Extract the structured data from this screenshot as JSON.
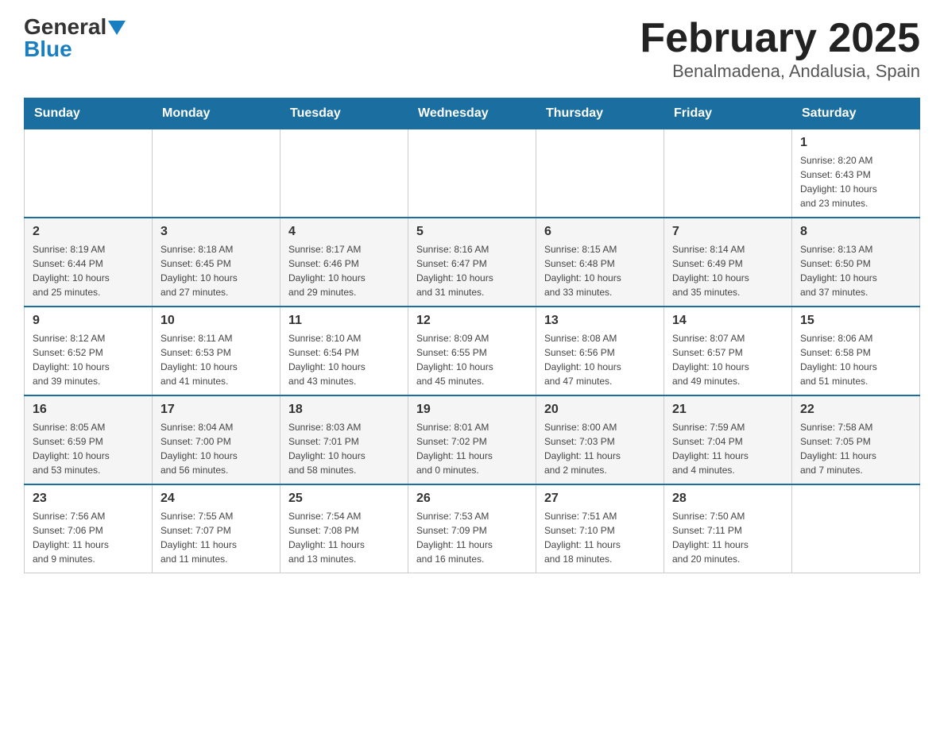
{
  "header": {
    "logo": {
      "general": "General",
      "blue": "Blue",
      "arrow": "▲"
    },
    "title": "February 2025",
    "subtitle": "Benalmadena, Andalusia, Spain"
  },
  "days_of_week": [
    "Sunday",
    "Monday",
    "Tuesday",
    "Wednesday",
    "Thursday",
    "Friday",
    "Saturday"
  ],
  "weeks": [
    {
      "days": [
        {
          "number": "",
          "info": ""
        },
        {
          "number": "",
          "info": ""
        },
        {
          "number": "",
          "info": ""
        },
        {
          "number": "",
          "info": ""
        },
        {
          "number": "",
          "info": ""
        },
        {
          "number": "",
          "info": ""
        },
        {
          "number": "1",
          "info": "Sunrise: 8:20 AM\nSunset: 6:43 PM\nDaylight: 10 hours\nand 23 minutes."
        }
      ]
    },
    {
      "days": [
        {
          "number": "2",
          "info": "Sunrise: 8:19 AM\nSunset: 6:44 PM\nDaylight: 10 hours\nand 25 minutes."
        },
        {
          "number": "3",
          "info": "Sunrise: 8:18 AM\nSunset: 6:45 PM\nDaylight: 10 hours\nand 27 minutes."
        },
        {
          "number": "4",
          "info": "Sunrise: 8:17 AM\nSunset: 6:46 PM\nDaylight: 10 hours\nand 29 minutes."
        },
        {
          "number": "5",
          "info": "Sunrise: 8:16 AM\nSunset: 6:47 PM\nDaylight: 10 hours\nand 31 minutes."
        },
        {
          "number": "6",
          "info": "Sunrise: 8:15 AM\nSunset: 6:48 PM\nDaylight: 10 hours\nand 33 minutes."
        },
        {
          "number": "7",
          "info": "Sunrise: 8:14 AM\nSunset: 6:49 PM\nDaylight: 10 hours\nand 35 minutes."
        },
        {
          "number": "8",
          "info": "Sunrise: 8:13 AM\nSunset: 6:50 PM\nDaylight: 10 hours\nand 37 minutes."
        }
      ]
    },
    {
      "days": [
        {
          "number": "9",
          "info": "Sunrise: 8:12 AM\nSunset: 6:52 PM\nDaylight: 10 hours\nand 39 minutes."
        },
        {
          "number": "10",
          "info": "Sunrise: 8:11 AM\nSunset: 6:53 PM\nDaylight: 10 hours\nand 41 minutes."
        },
        {
          "number": "11",
          "info": "Sunrise: 8:10 AM\nSunset: 6:54 PM\nDaylight: 10 hours\nand 43 minutes."
        },
        {
          "number": "12",
          "info": "Sunrise: 8:09 AM\nSunset: 6:55 PM\nDaylight: 10 hours\nand 45 minutes."
        },
        {
          "number": "13",
          "info": "Sunrise: 8:08 AM\nSunset: 6:56 PM\nDaylight: 10 hours\nand 47 minutes."
        },
        {
          "number": "14",
          "info": "Sunrise: 8:07 AM\nSunset: 6:57 PM\nDaylight: 10 hours\nand 49 minutes."
        },
        {
          "number": "15",
          "info": "Sunrise: 8:06 AM\nSunset: 6:58 PM\nDaylight: 10 hours\nand 51 minutes."
        }
      ]
    },
    {
      "days": [
        {
          "number": "16",
          "info": "Sunrise: 8:05 AM\nSunset: 6:59 PM\nDaylight: 10 hours\nand 53 minutes."
        },
        {
          "number": "17",
          "info": "Sunrise: 8:04 AM\nSunset: 7:00 PM\nDaylight: 10 hours\nand 56 minutes."
        },
        {
          "number": "18",
          "info": "Sunrise: 8:03 AM\nSunset: 7:01 PM\nDaylight: 10 hours\nand 58 minutes."
        },
        {
          "number": "19",
          "info": "Sunrise: 8:01 AM\nSunset: 7:02 PM\nDaylight: 11 hours\nand 0 minutes."
        },
        {
          "number": "20",
          "info": "Sunrise: 8:00 AM\nSunset: 7:03 PM\nDaylight: 11 hours\nand 2 minutes."
        },
        {
          "number": "21",
          "info": "Sunrise: 7:59 AM\nSunset: 7:04 PM\nDaylight: 11 hours\nand 4 minutes."
        },
        {
          "number": "22",
          "info": "Sunrise: 7:58 AM\nSunset: 7:05 PM\nDaylight: 11 hours\nand 7 minutes."
        }
      ]
    },
    {
      "days": [
        {
          "number": "23",
          "info": "Sunrise: 7:56 AM\nSunset: 7:06 PM\nDaylight: 11 hours\nand 9 minutes."
        },
        {
          "number": "24",
          "info": "Sunrise: 7:55 AM\nSunset: 7:07 PM\nDaylight: 11 hours\nand 11 minutes."
        },
        {
          "number": "25",
          "info": "Sunrise: 7:54 AM\nSunset: 7:08 PM\nDaylight: 11 hours\nand 13 minutes."
        },
        {
          "number": "26",
          "info": "Sunrise: 7:53 AM\nSunset: 7:09 PM\nDaylight: 11 hours\nand 16 minutes."
        },
        {
          "number": "27",
          "info": "Sunrise: 7:51 AM\nSunset: 7:10 PM\nDaylight: 11 hours\nand 18 minutes."
        },
        {
          "number": "28",
          "info": "Sunrise: 7:50 AM\nSunset: 7:11 PM\nDaylight: 11 hours\nand 20 minutes."
        },
        {
          "number": "",
          "info": ""
        }
      ]
    }
  ]
}
